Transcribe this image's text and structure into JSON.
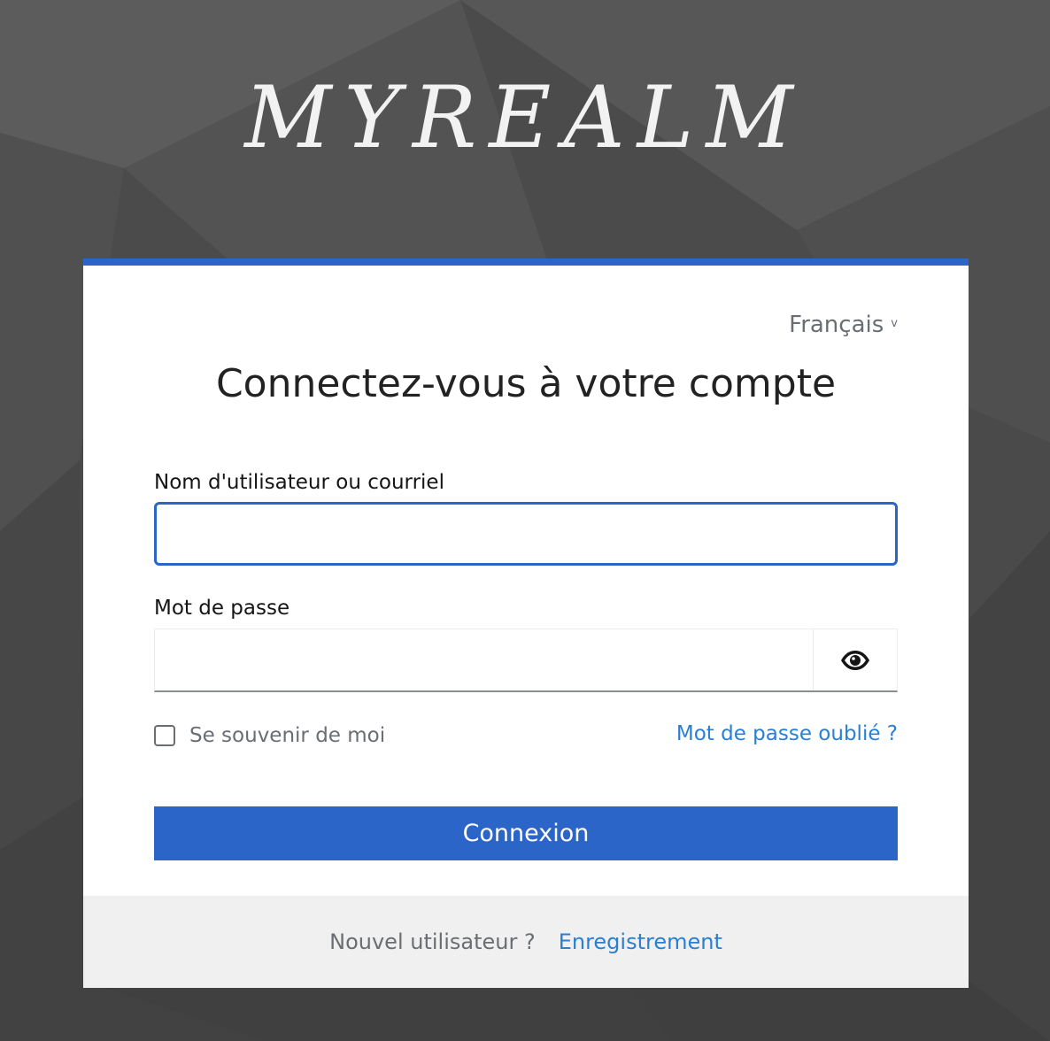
{
  "realm": {
    "title": "MYREALM"
  },
  "login": {
    "language": "Français",
    "heading": "Connectez-vous à votre compte",
    "username_label": "Nom d'utilisateur ou courriel",
    "username_value": "",
    "password_label": "Mot de passe",
    "password_value": "",
    "remember_label": "Se souvenir de moi",
    "remember_checked": false,
    "forgot_link": "Mot de passe oublié ?",
    "submit_label": "Connexion"
  },
  "footer": {
    "new_user_text": "Nouvel utilisateur ?",
    "register_link": "Enregistrement"
  },
  "colors": {
    "accent": "#2b65c8",
    "link": "#2b7fd0",
    "background": "#4a4a4a",
    "footer_bg": "#f0f0f0"
  },
  "icons": {
    "language_toggle": "chevron-down-icon",
    "password_toggle": "eye-icon"
  }
}
